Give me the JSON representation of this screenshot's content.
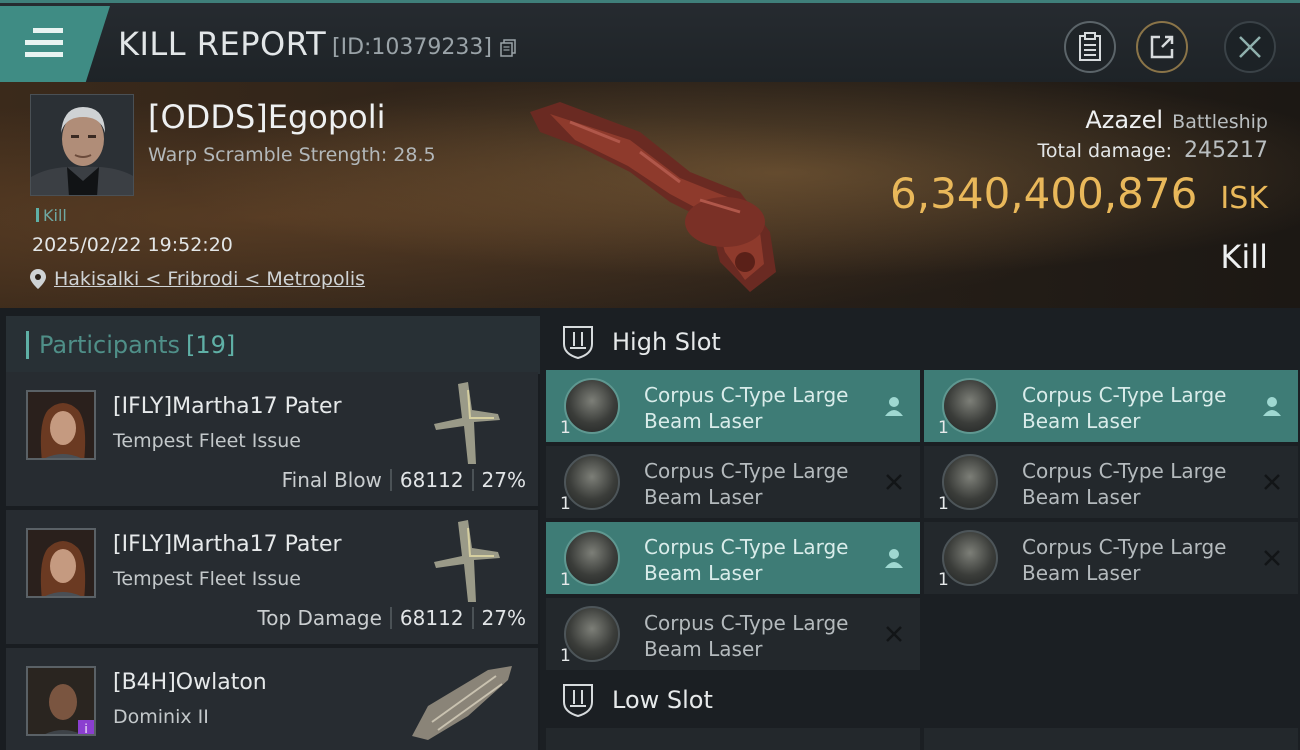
{
  "header": {
    "title": "KILL REPORT",
    "report_id": "[ID:10379233]"
  },
  "victim": {
    "pilot": "[ODDS]Egopoli",
    "warp_scramble": "Warp Scramble Strength: 28.5",
    "tag": "Kill",
    "datetime": "2025/02/22 19:52:20",
    "location": "Hakisalki < Fribrodi < Metropolis",
    "ship_name": "Azazel",
    "ship_class": "Battleship",
    "total_damage_label": "Total damage:",
    "total_damage": "245217",
    "isk_value": "6,340,400,876",
    "isk_unit": "ISK",
    "result": "Kill"
  },
  "participants": {
    "label": "Participants",
    "count": "[19]",
    "items": [
      {
        "name": "[IFLY]Martha17 Pater",
        "ship": "Tempest Fleet Issue",
        "role": "Final Blow",
        "damage": "68112",
        "percent": "27%"
      },
      {
        "name": "[IFLY]Martha17 Pater",
        "ship": "Tempest Fleet Issue",
        "role": "Top Damage",
        "damage": "68112",
        "percent": "27%"
      },
      {
        "name": "[B4H]Owlaton",
        "ship": "Dominix II"
      }
    ]
  },
  "fitting": {
    "high_slot_label": "High Slot",
    "low_slot_label": "Low Slot",
    "high_modules": [
      {
        "line1": "Corpus C-Type Large",
        "line2": "Beam Laser",
        "qty": "1",
        "status": "person-icon"
      },
      {
        "line1": "Corpus C-Type Large",
        "line2": "Beam Laser",
        "qty": "1",
        "status": "person-icon"
      },
      {
        "line1": "Corpus C-Type Large",
        "line2": "Beam Laser",
        "qty": "1",
        "status": "x-icon"
      },
      {
        "line1": "Corpus C-Type Large",
        "line2": "Beam Laser",
        "qty": "1",
        "status": "x-icon"
      },
      {
        "line1": "Corpus C-Type Large",
        "line2": "Beam Laser",
        "qty": "1",
        "status": "person-icon"
      },
      {
        "line1": "Corpus C-Type Large",
        "line2": "Beam Laser",
        "qty": "1",
        "status": "x-icon"
      },
      {
        "line1": "Corpus C-Type Large",
        "line2": "Beam Laser",
        "qty": "1",
        "status": "x-icon"
      }
    ]
  },
  "colors": {
    "accent_teal": "#3f8c84",
    "isk_gold": "#e9b85a",
    "module_manned": "#3e7c76"
  }
}
